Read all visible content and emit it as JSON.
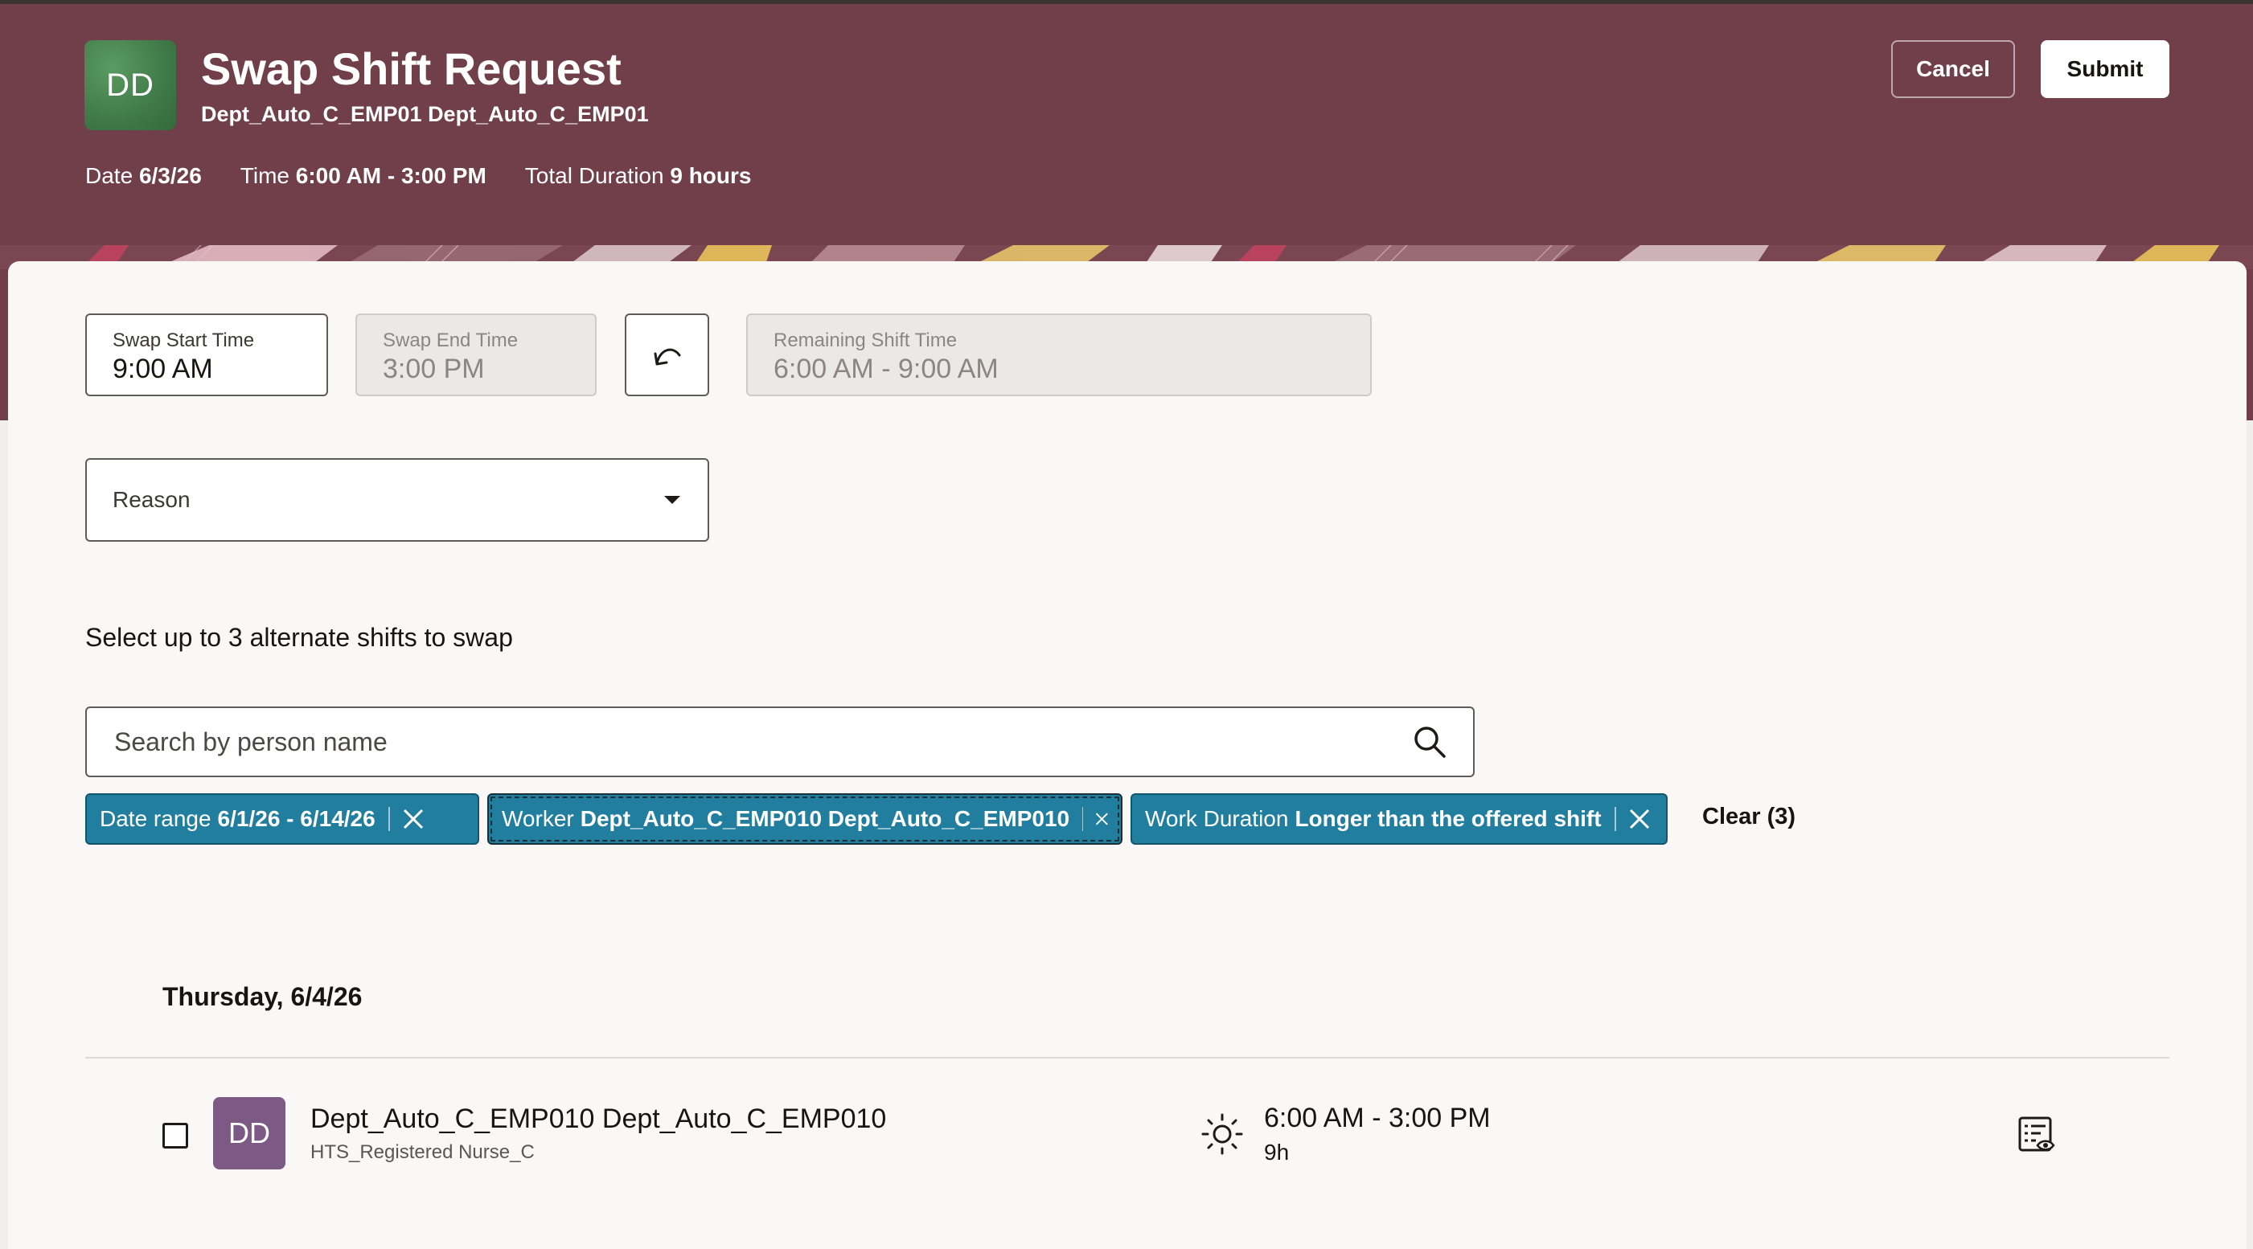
{
  "header": {
    "avatar_initials": "DD",
    "title": "Swap Shift Request",
    "subtitle": "Dept_Auto_C_EMP01 Dept_Auto_C_EMP01",
    "date_label": "Date",
    "date_value": "6/3/26",
    "time_label": "Time",
    "time_value": "6:00 AM - 3:00 PM",
    "duration_label": "Total Duration",
    "duration_value": "9 hours",
    "cancel_label": "Cancel",
    "submit_label": "Submit",
    "bg_color": "#703f4a"
  },
  "form": {
    "swap_start": {
      "label": "Swap Start Time",
      "value": "9:00 AM"
    },
    "swap_end": {
      "label": "Swap End Time",
      "value": "3:00 PM"
    },
    "reset_icon": "undo-arrow-icon",
    "remaining": {
      "label": "Remaining Shift Time",
      "value": "6:00 AM - 9:00 AM"
    },
    "reason": {
      "placeholder": "Reason"
    }
  },
  "alternates": {
    "instruction": "Select up to 3 alternate shifts to swap",
    "search_placeholder": "Search by person name",
    "filters": [
      {
        "label": "Date range",
        "value": "6/1/26 - 6/14/26"
      },
      {
        "label": "Worker",
        "value": "Dept_Auto_C_EMP010 Dept_Auto_C_EMP010"
      },
      {
        "label": "Work Duration",
        "value": "Longer than the offered shift"
      }
    ],
    "clear_label": "Clear (3)",
    "chip_color": "#227e9e"
  },
  "results": {
    "day_heading": "Thursday, 6/4/26",
    "rows": [
      {
        "initials": "DD",
        "name": "Dept_Auto_C_EMP010 Dept_Auto_C_EMP010",
        "role": "HTS_Registered Nurse_C",
        "shift_icon": "sun-icon",
        "time": "6:00 AM - 3:00 PM",
        "duration": "9h"
      }
    ]
  }
}
